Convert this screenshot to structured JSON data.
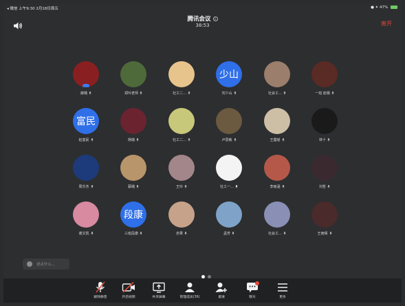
{
  "statusbar": {
    "left": "◂ 微信  上午9:30  2月18日周五",
    "right": "● ✦ 47%"
  },
  "header": {
    "title": "腾讯会议",
    "timer": "38:53",
    "leave_label": "离开"
  },
  "participants": [
    {
      "name": "薛璐",
      "avatar_text": "",
      "color": "#8a1f22",
      "mic": "on",
      "badge": true
    },
    {
      "name": "郑玲老师",
      "avatar_text": "",
      "color": "#4f6a3a",
      "mic": "on"
    },
    {
      "name": "社工二…",
      "avatar_text": "",
      "color": "#e7c48c",
      "mic": "on"
    },
    {
      "name": "刘少山",
      "avatar_text": "少山",
      "color": "#2f6fe8",
      "mic": "on"
    },
    {
      "name": "社会工…",
      "avatar_text": "",
      "color": "#9b7e6b",
      "mic": "on"
    },
    {
      "name": "一班 赵璐",
      "avatar_text": "",
      "color": "#5a2a24",
      "mic": "on"
    },
    {
      "name": "赵富民",
      "avatar_text": "富民",
      "color": "#2f6fe8",
      "mic": "on"
    },
    {
      "name": "杨璐",
      "avatar_text": "",
      "color": "#6b2330",
      "mic": "on"
    },
    {
      "name": "社工二…",
      "avatar_text": "",
      "color": "#c8c87a",
      "mic": "on"
    },
    {
      "name": "卢思敏",
      "avatar_text": "",
      "color": "#6b5a40",
      "mic": "on"
    },
    {
      "name": "王露瑶",
      "avatar_text": "",
      "color": "#cdbfa6",
      "mic": "on"
    },
    {
      "name": "林十",
      "avatar_text": "",
      "color": "#1a1a1a",
      "mic": "on"
    },
    {
      "name": "周乐杰",
      "avatar_text": "",
      "color": "#1d3b7a",
      "mic": "on"
    },
    {
      "name": "蔡璐",
      "avatar_text": "",
      "color": "#b8956a",
      "mic": "on"
    },
    {
      "name": "王玲",
      "avatar_text": "",
      "color": "#a2868a",
      "mic": "on"
    },
    {
      "name": "社工一…",
      "avatar_text": "",
      "color": "#f4f4f4",
      "mic": "on-white"
    },
    {
      "name": "李雨涵",
      "avatar_text": "",
      "color": "#b5584a",
      "mic": "on"
    },
    {
      "name": "刘哲",
      "avatar_text": "",
      "color": "#3a2a30",
      "mic": "on"
    },
    {
      "name": "谢文凯",
      "avatar_text": "",
      "color": "#d78aa0",
      "mic": "on"
    },
    {
      "name": "三班段康",
      "avatar_text": "段康",
      "color": "#2f6fe8",
      "mic": "on"
    },
    {
      "name": "赤果",
      "avatar_text": "",
      "color": "#c6a28a",
      "mic": "on"
    },
    {
      "name": "孟芳",
      "avatar_text": "",
      "color": "#7fa3c8",
      "mic": "on"
    },
    {
      "name": "社会工…",
      "avatar_text": "",
      "color": "#8a8fb5",
      "mic": "on"
    },
    {
      "name": "王雨晴",
      "avatar_text": "",
      "color": "#4a2a2a",
      "mic": "on"
    }
  ],
  "chat": {
    "placeholder": "说点什么..."
  },
  "pager": {
    "pages": 2,
    "current": 1
  },
  "toolbar": [
    {
      "key": "mute",
      "label": "解除静音",
      "icon": "mic-muted-icon"
    },
    {
      "key": "video",
      "label": "开启视频",
      "icon": "video-off-icon"
    },
    {
      "key": "share",
      "label": "共享屏幕",
      "icon": "share-screen-icon"
    },
    {
      "key": "members",
      "label": "管理成员(36)",
      "icon": "members-icon"
    },
    {
      "key": "invite",
      "label": "邀请",
      "icon": "invite-icon"
    },
    {
      "key": "chat",
      "label": "聊天",
      "icon": "chat-icon"
    },
    {
      "key": "more",
      "label": "更多",
      "icon": "more-icon"
    }
  ],
  "colors": {
    "accent_blue": "#2f6fe8",
    "leave_red": "#e0453a",
    "muted_red": "#e14b3b"
  }
}
